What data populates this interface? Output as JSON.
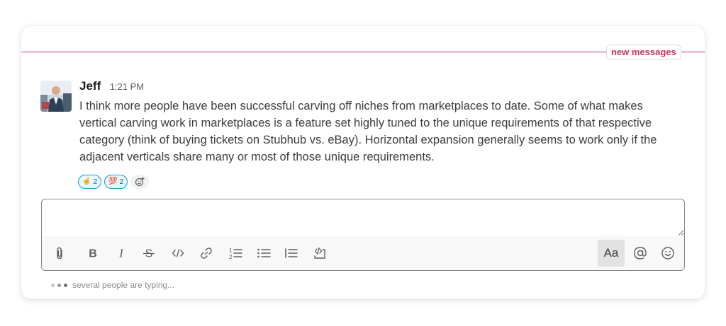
{
  "divider": {
    "label": "new messages",
    "color": "#c8345c"
  },
  "message": {
    "author": "Jeff",
    "time": "1:21 PM",
    "text": "I think more people have been successful carving off niches from marketplaces to date. Some of what makes vertical carving work in marketplaces is a feature set highly tuned to the unique requirements of that respective category (think of buying tickets on Stubhub vs. eBay). Horizontal expansion generally seems to work only if the adjacent verticals share many or most of those unique requirements.",
    "reactions": [
      {
        "emoji": "☝️",
        "icon": "point-up-icon",
        "count": "2"
      },
      {
        "emoji": "💯",
        "icon": "hundred-points-icon",
        "count": "2"
      }
    ],
    "add_reaction_icon": "add-reaction-icon"
  },
  "composer": {
    "placeholder": "",
    "value": "",
    "font_button_label": "Aa",
    "tools": [
      "attachment-icon",
      "bold-icon",
      "italic-icon",
      "strikethrough-icon",
      "code-icon",
      "link-icon",
      "numbered-list-icon",
      "bulleted-list-icon",
      "blockquote-icon",
      "code-block-icon",
      "at-mention-icon",
      "emoji-icon"
    ]
  },
  "typing": {
    "text": "several people are typing..."
  },
  "colors": {
    "accent": "#c8345c",
    "reaction_border": "#1d9bd1",
    "reaction_bg": "#e8f5fa"
  }
}
